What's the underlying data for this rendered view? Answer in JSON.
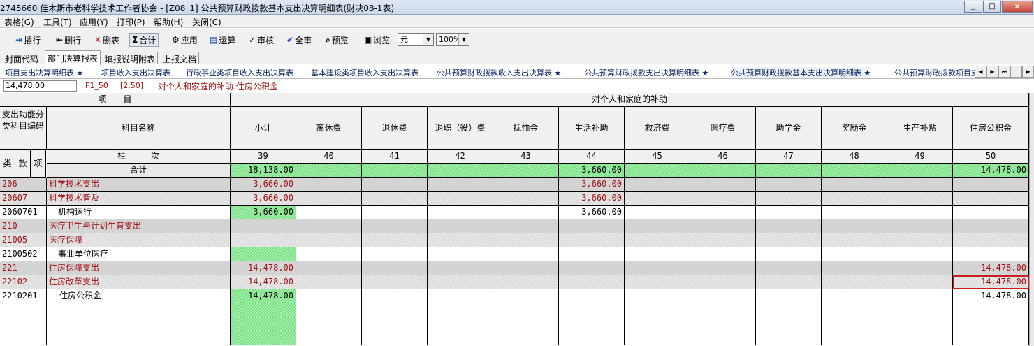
{
  "window": {
    "title": "2745660  佳木斯市老科学技术工作者协会 - [Z08_1] 公共预算财政拨款基本支出决算明细表(财决08-1表)",
    "controls": [
      "_",
      "□",
      "×"
    ]
  },
  "menu": [
    "表格(G)",
    "工具(T)",
    "应用(Y)",
    "打印(P)",
    "帮助(H)",
    "关闭(C)"
  ],
  "toolbar": {
    "insert_row": "插行",
    "delete_row": "删行",
    "delete_table": "删表",
    "total": "合计",
    "apply": "应用",
    "calculate": "运算",
    "audit": "审核",
    "audit_all": "全审",
    "preview": "预览",
    "browse": "浏览",
    "unit": "元",
    "zoom": "100%"
  },
  "tabs_level1": [
    "封面代码",
    "部门决算报表",
    "填报说明附表",
    "上报文档"
  ],
  "tabs_level2": [
    "项目支出决算明细表 ★",
    "项目收入支出决算表",
    "行政事业类项目收入支出决算表",
    "基本建设类项目收入支出决算表",
    "公共预算财政拨款收入支出决算表 ★",
    "公共预算财政拨款支出决算明细表 ★",
    "公共预算财政拨款基本支出决算明细表 ★",
    "公共预算财政拨款项目支"
  ],
  "formula": {
    "value": "14,478.00",
    "cell_id": "F1_50",
    "position": "[2,50]",
    "description": "对个人和家庭的补助.住房公积金"
  },
  "table": {
    "header_item": "项　　目",
    "header_group": "对个人和家庭的补助",
    "code_header": "支出功能分类科目编码",
    "name_header": "科目名称",
    "lanci": "栏　　　次",
    "class_labels": [
      "类",
      "款",
      "项"
    ],
    "columns": [
      {
        "label": "小计",
        "no": "39"
      },
      {
        "label": "离休费",
        "no": "40"
      },
      {
        "label": "退休费",
        "no": "41"
      },
      {
        "label": "退职（役）费",
        "no": "42"
      },
      {
        "label": "抚恤金",
        "no": "43"
      },
      {
        "label": "生活补助",
        "no": "44"
      },
      {
        "label": "救济费",
        "no": "45"
      },
      {
        "label": "医疗费",
        "no": "46"
      },
      {
        "label": "助学金",
        "no": "47"
      },
      {
        "label": "奖励金",
        "no": "48"
      },
      {
        "label": "生产补贴",
        "no": "49"
      },
      {
        "label": "住房公积金",
        "no": "50"
      }
    ],
    "total_label": "合计",
    "total_values": [
      "18,138.00",
      "",
      "",
      "",
      "",
      "3,660.00",
      "",
      "",
      "",
      "",
      "",
      "14,478.00"
    ],
    "rows": [
      {
        "code": "206",
        "name": "科学技术支出",
        "level": 1,
        "values": [
          "3,660.00",
          "",
          "",
          "",
          "",
          "3,660.00",
          "",
          "",
          "",
          "",
          "",
          ""
        ]
      },
      {
        "code": "20607",
        "name": "科学技术普及",
        "level": 2,
        "values": [
          "3,660.00",
          "",
          "",
          "",
          "",
          "3,660.00",
          "",
          "",
          "",
          "",
          "",
          ""
        ]
      },
      {
        "code": "2060701",
        "name": "机构运行",
        "level": 3,
        "values": [
          "3,660.00",
          "",
          "",
          "",
          "",
          "3,660.00",
          "",
          "",
          "",
          "",
          "",
          ""
        ]
      },
      {
        "code": "210",
        "name": "医疗卫生与计划生育支出",
        "level": 1,
        "values": [
          "",
          "",
          "",
          "",
          "",
          "",
          "",
          "",
          "",
          "",
          "",
          ""
        ]
      },
      {
        "code": "21005",
        "name": "医疗保障",
        "level": 2,
        "values": [
          "",
          "",
          "",
          "",
          "",
          "",
          "",
          "",
          "",
          "",
          "",
          ""
        ]
      },
      {
        "code": "2100502",
        "name": "事业单位医疗",
        "level": 3,
        "values": [
          "",
          "",
          "",
          "",
          "",
          "",
          "",
          "",
          "",
          "",
          "",
          ""
        ]
      },
      {
        "code": "221",
        "name": "住房保障支出",
        "level": 1,
        "values": [
          "14,478.00",
          "",
          "",
          "",
          "",
          "",
          "",
          "",
          "",
          "",
          "",
          "14,478.00"
        ]
      },
      {
        "code": "22102",
        "name": "住房改革支出",
        "level": 2,
        "values": [
          "14,478.00",
          "",
          "",
          "",
          "",
          "",
          "",
          "",
          "",
          "",
          "",
          "14,478.00"
        ]
      },
      {
        "code": "2210201",
        "name": "住房公积金",
        "level": 3,
        "values": [
          "14,478.00",
          "",
          "",
          "",
          "",
          "",
          "",
          "",
          "",
          "",
          "",
          "14,478.00"
        ]
      }
    ],
    "empty_rows": 3
  }
}
